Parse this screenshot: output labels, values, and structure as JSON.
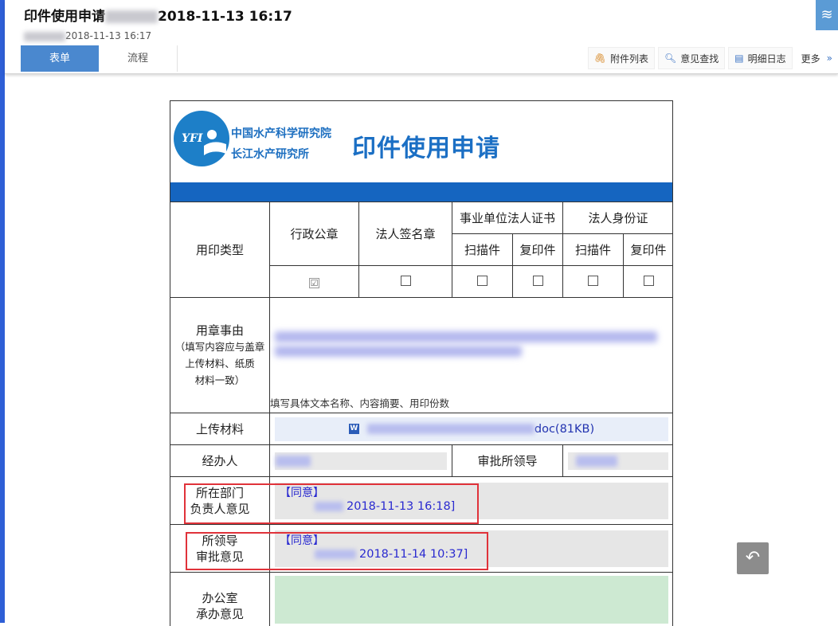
{
  "header": {
    "title_prefix": "印件使用申请",
    "title_suffix": "2018-11-13 16:17",
    "subtitle_time": "2018-11-13 16:17"
  },
  "tabs": [
    {
      "label": "表单",
      "active": true
    },
    {
      "label": "流程",
      "active": false
    }
  ],
  "toolbar": {
    "attachments": "附件列表",
    "opinion_search": "意见查找",
    "detail_log": "明细日志",
    "more": "更多"
  },
  "form": {
    "logo_abbr": "YFI",
    "org_line1": "中国水产科学研究院",
    "org_line2": "长江水产研究所",
    "title": "印件使用申请",
    "seal_type_label": "用印类型",
    "col_admin_seal": "行政公章",
    "col_legal_sign": "法人签名章",
    "col_certificate": "事业单位法人证书",
    "col_legal_id": "法人身份证",
    "sub_scan": "扫描件",
    "sub_copy": "复印件",
    "checkbox_checked_mark": "☑",
    "reason_label": "用章事由",
    "reason_note_1": "（填写内容应与盖章",
    "reason_note_2": "上传材料、纸质",
    "reason_note_3": "材料一致）",
    "reason_hint": "填写具体文本名称、内容摘要、用印份数",
    "upload_label": "上传材料",
    "upload_file_suffix": "doc(81KB)",
    "handler_label": "经办人",
    "approver_label": "审批所领导",
    "dept_opinion_label_1": "所在部门",
    "dept_opinion_label_2": "负责人意见",
    "dept_opinion_agree": "【同意】",
    "dept_opinion_sig": "2018-11-13 16:18]",
    "leader_opinion_label_1": "所领导",
    "leader_opinion_label_2": "审批意见",
    "leader_opinion_agree": "【同意】",
    "leader_opinion_sig": "2018-11-14 10:37]",
    "office_label_1": "办公室",
    "office_label_2": "承办意见"
  },
  "colors": {
    "accent_blue": "#4a88cf",
    "form_blue": "#1565c0",
    "annotation_red": "#e0323a",
    "opinion_text": "#2a2ad0"
  },
  "icons": {
    "attachments": "paperclip-icon",
    "opinion_search": "search-icon",
    "detail_log": "document-icon",
    "more": "chevron-double-down-icon",
    "layers": "layers-icon",
    "reply": "reply-icon"
  }
}
